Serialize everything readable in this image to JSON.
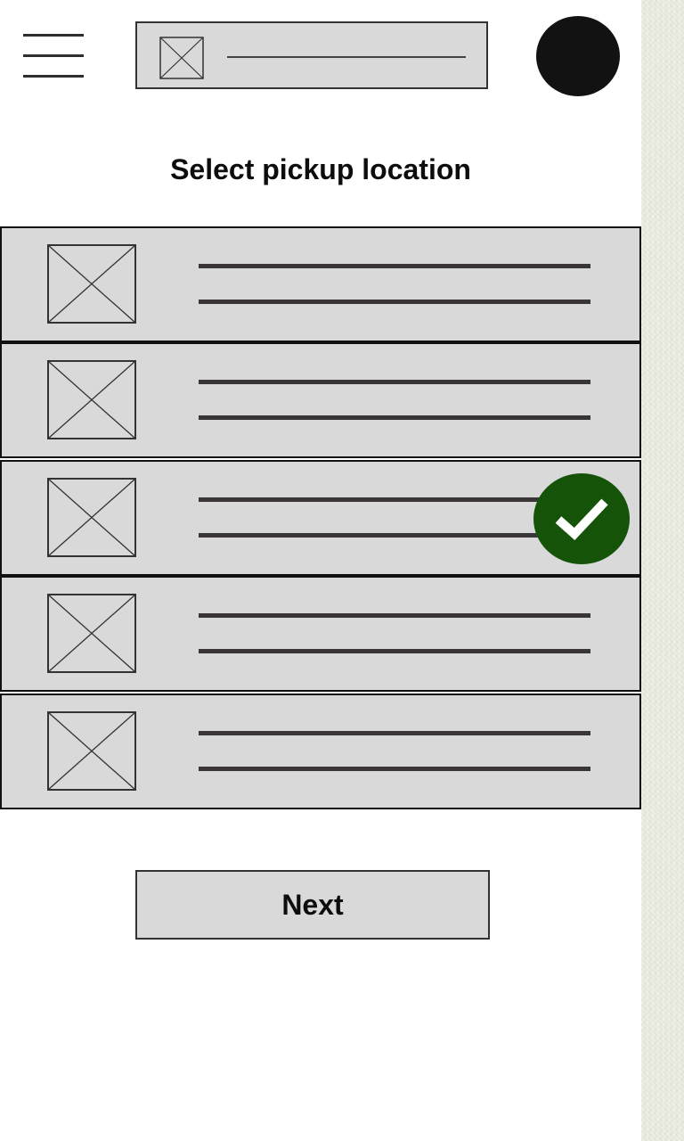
{
  "header": {
    "menu_icon": "hamburger-menu-icon",
    "search_image_icon": "image-placeholder-icon",
    "avatar_icon": "user-avatar"
  },
  "main": {
    "title": "Select pickup location",
    "locations": [
      {
        "selected": false
      },
      {
        "selected": false
      },
      {
        "selected": true
      },
      {
        "selected": false
      },
      {
        "selected": false
      }
    ],
    "check_icon": "check-icon",
    "next_label": "Next"
  },
  "colors": {
    "selected_badge": "#155309",
    "item_fill": "#d9d9d9",
    "avatar": "#121212"
  }
}
